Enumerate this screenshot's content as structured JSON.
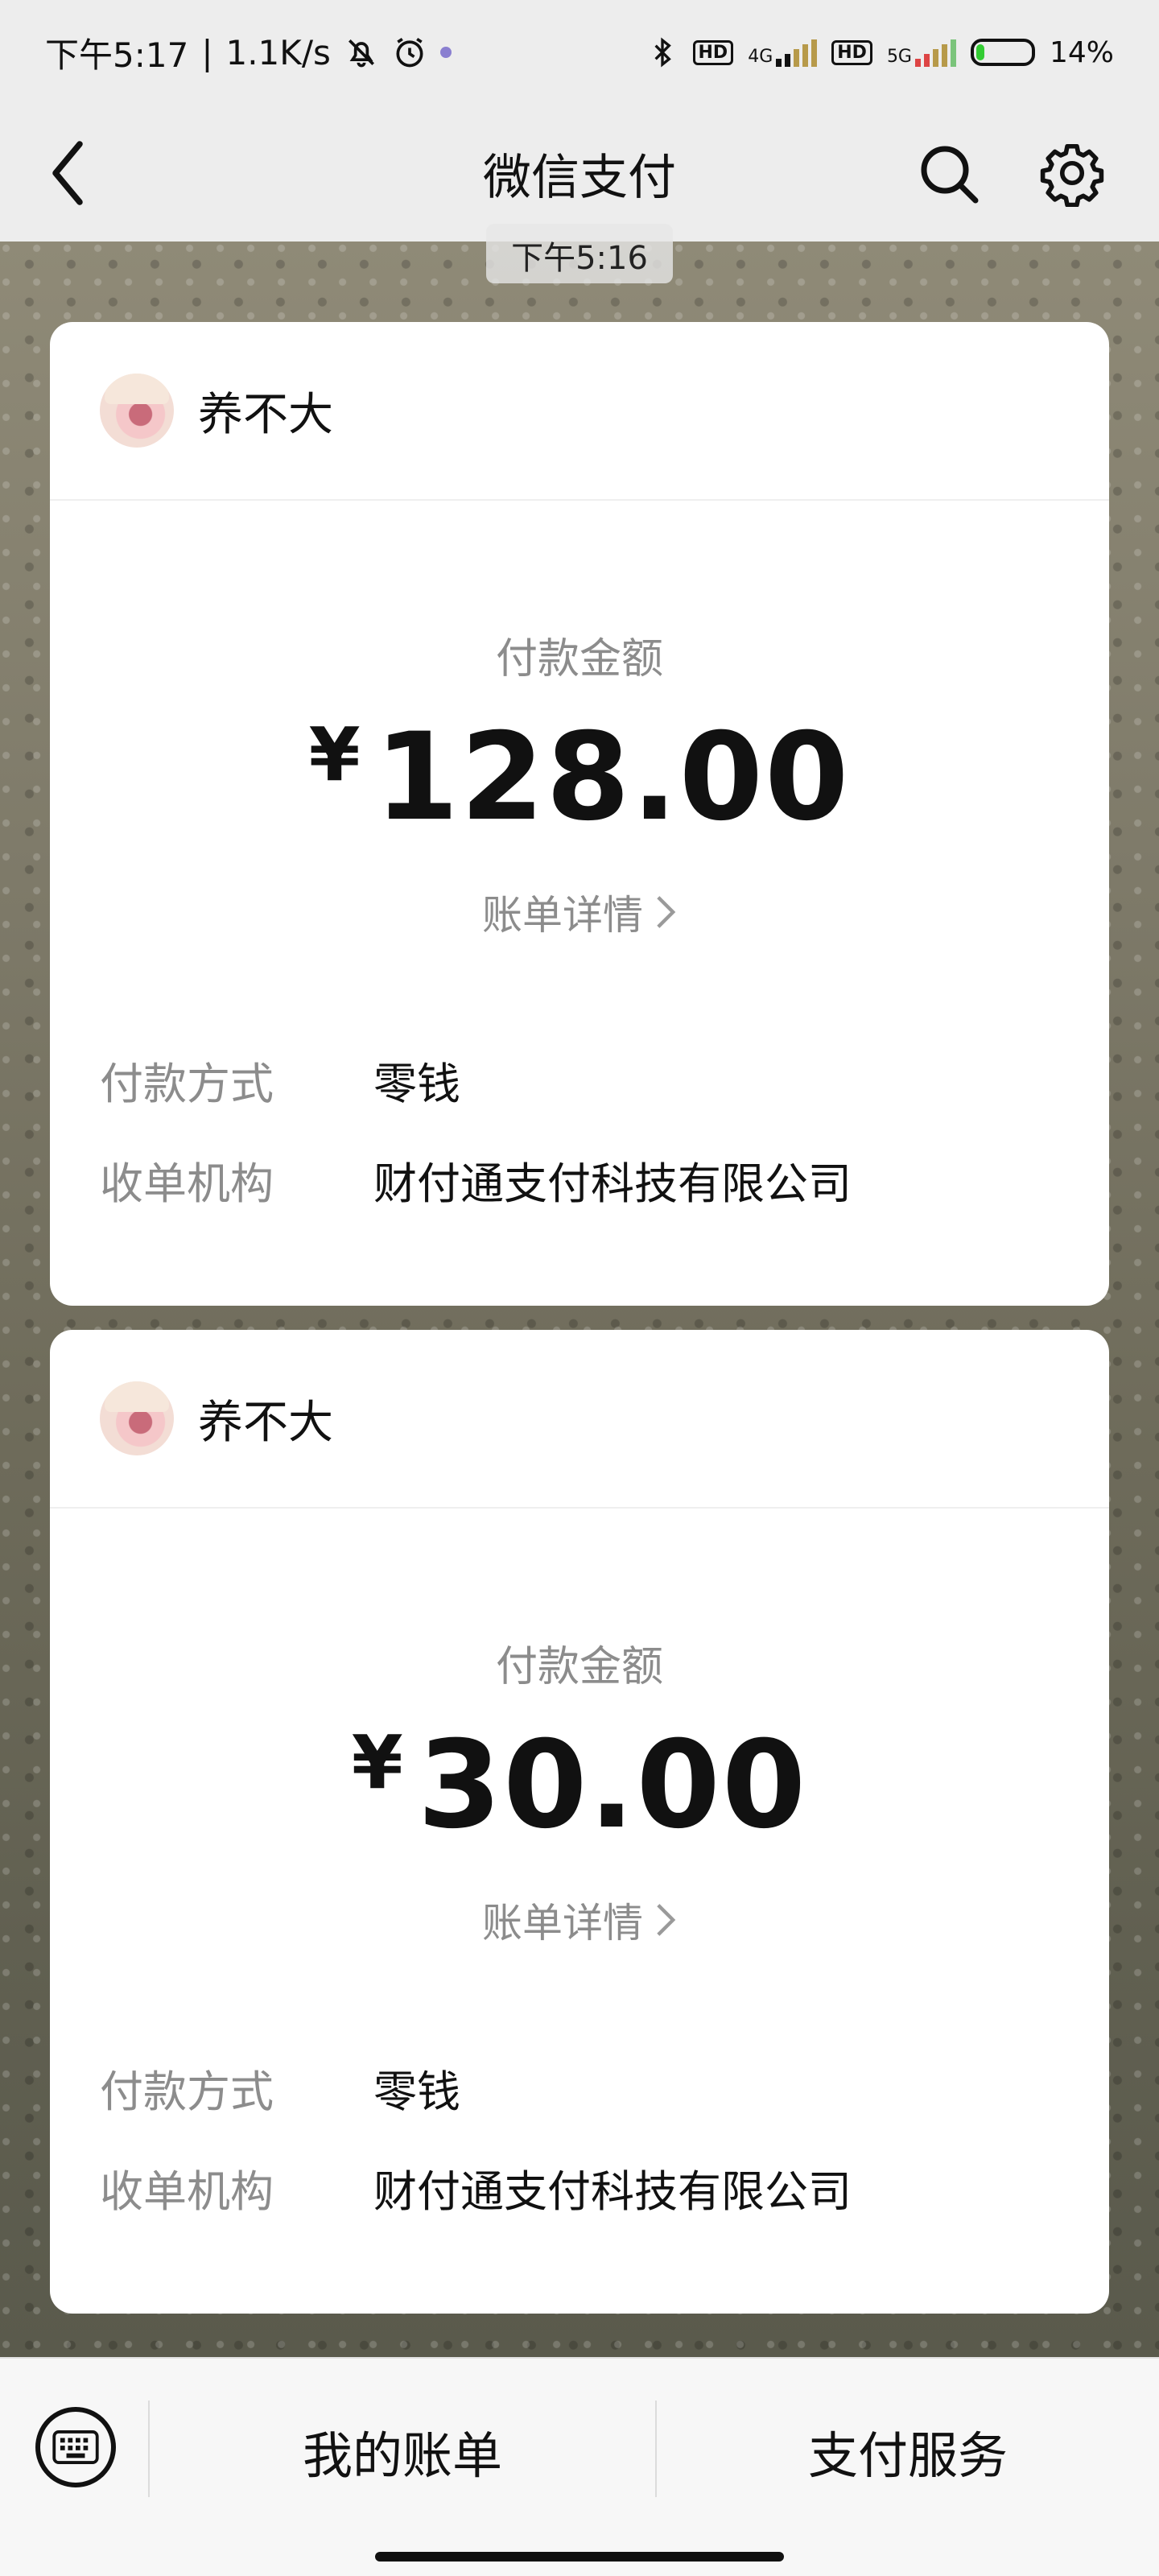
{
  "status_bar": {
    "time": "下午5:17",
    "speed": "1.1K/s",
    "network1": "4G",
    "network2": "5G",
    "hd1": "HD",
    "hd2": "HD",
    "battery": "14%"
  },
  "navbar": {
    "title": "微信支付",
    "back_icon": "chevron-left-icon",
    "search_icon": "search-icon",
    "settings_icon": "gear-icon"
  },
  "chat_time": "下午5:16",
  "payments": [
    {
      "merchant": "养不大",
      "amount_label": "付款金额",
      "currency": "¥",
      "amount": "128.00",
      "detail_link": "账单详情",
      "method_label": "付款方式",
      "method_value": "零钱",
      "acquirer_label": "收单机构",
      "acquirer_value": "财付通支付科技有限公司"
    },
    {
      "merchant": "养不大",
      "amount_label": "付款金额",
      "currency": "¥",
      "amount": "30.00",
      "detail_link": "账单详情",
      "method_label": "付款方式",
      "method_value": "零钱",
      "acquirer_label": "收单机构",
      "acquirer_value": "财付通支付科技有限公司"
    }
  ],
  "bottom_menu": {
    "keyboard_icon": "keyboard-icon",
    "item1": "我的账单",
    "item2": "支付服务"
  }
}
